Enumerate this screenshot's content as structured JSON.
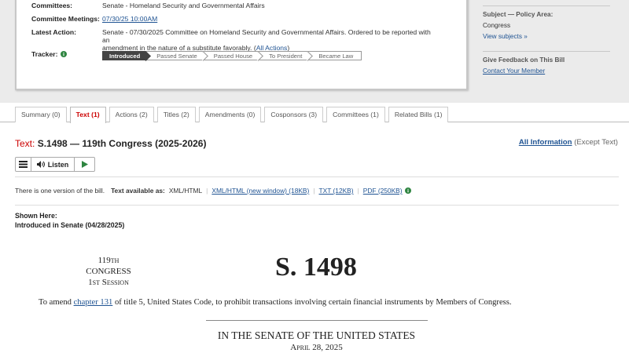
{
  "overview": {
    "committees_label": "Committees:",
    "committees_value": "Senate - Homeland Security and Governmental Affairs",
    "meetings_label": "Committee Meetings:",
    "meetings_value": "07/30/25 10:00AM",
    "latest_label": "Latest Action:",
    "latest_value_line1": "Senate - 07/30/2025 Committee on Homeland Security and Governmental Affairs. Ordered to be reported with an",
    "latest_value_line2": "amendment in the nature of a substitute favorably.",
    "all_actions_link": "All Actions",
    "tracker_label": "Tracker:",
    "tracker_steps": [
      "Introduced",
      "Passed Senate",
      "Passed House",
      "To President",
      "Became Law"
    ],
    "tracker_active_index": 0
  },
  "sidebar": {
    "policy_title": "Subject — Policy Area:",
    "policy_value": "Congress",
    "view_subjects": "View subjects",
    "feedback_title": "Give Feedback on This Bill",
    "contact_link": "Contact Your Member"
  },
  "tabs": [
    {
      "label": "Summary (0)",
      "active": false
    },
    {
      "label": "Text (1)",
      "active": true
    },
    {
      "label": "Actions (2)",
      "active": false
    },
    {
      "label": "Titles (2)",
      "active": false
    },
    {
      "label": "Amendments (0)",
      "active": false
    },
    {
      "label": "Cosponsors (3)",
      "active": false
    },
    {
      "label": "Committees (1)",
      "active": false
    },
    {
      "label": "Related Bills (1)",
      "active": false
    }
  ],
  "text_section": {
    "prefix": "Text:",
    "title": "S.1498 — 119th Congress (2025-2026)",
    "all_info_link": "All Information",
    "all_info_suffix": "(Except Text)",
    "listen_label": "Listen",
    "versions_text": "There is one version of the bill.",
    "available_label": "Text available as:",
    "format_current": "XML/HTML",
    "format_links": [
      "XML/HTML (new window) (18KB)",
      "TXT (12KB)",
      "PDF (250KB)"
    ],
    "shown_here_label": "Shown Here:",
    "shown_here_value": "Introduced in Senate (04/28/2025)"
  },
  "document": {
    "congress_line1": "119th CONGRESS",
    "congress_line2": "1st Session",
    "bill_number": "S. 1498",
    "purpose_prefix": "To amend",
    "purpose_link": "chapter 131",
    "purpose_suffix": "of title 5, United States Code, to prohibit transactions involving certain financial instruments by Members of Congress.",
    "chamber": "IN THE SENATE OF THE UNITED STATES",
    "date": "April 28, 2025"
  },
  "colors": {
    "accent_red": "#cc0000",
    "link_blue": "#205493",
    "tracker_active": "#444444",
    "info_green": "#2e8540"
  }
}
